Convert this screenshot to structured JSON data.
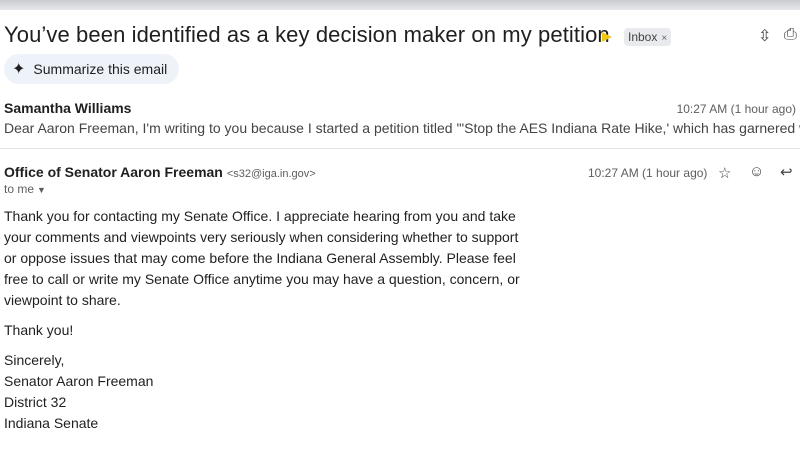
{
  "email": {
    "subject": "You’ve been identified as a key decision maker on my petition",
    "label": "Inbox",
    "label_close": "×",
    "summarize_label": "Summarize this email",
    "thread": [
      {
        "sender": "Samantha Williams",
        "time": "10:27 AM (1 hour ago)",
        "snippet": "Dear Aaron Freeman, I'm writing to you because I started a petition titled '\"Stop the AES Indiana Rate Hike,' which has garnered w"
      }
    ],
    "message": {
      "from_name": "Office of Senator Aaron Freeman",
      "from_email": "<s32@iga.in.gov>",
      "to": "to me",
      "time": "10:27 AM (1 hour ago)",
      "paragraph1": "Thank you for contacting my Senate Office. I appreciate hearing from you and take your comments and viewpoints very seriously when considering whether to support or oppose issues that may come before the Indiana General Assembly. Please feel free to call or write my Senate Office anytime you may have a question, concern, or viewpoint to share.",
      "paragraph2": "Thank you!",
      "signature": [
        "Sincerely,",
        "Senator Aaron Freeman",
        "District 32",
        "Indiana Senate"
      ]
    }
  },
  "icons": {
    "importance": "importance-marker-icon",
    "sparkle": "sparkle-icon",
    "star": "star-icon",
    "emoji": "emoji-icon",
    "reply": "reply-icon",
    "expand": "expand-collapse-icon",
    "print": "print-icon"
  },
  "colors": {
    "importance": "#f2c811",
    "chip_bg": "#e8eaed",
    "summarize_bg": "#eef2f9"
  }
}
